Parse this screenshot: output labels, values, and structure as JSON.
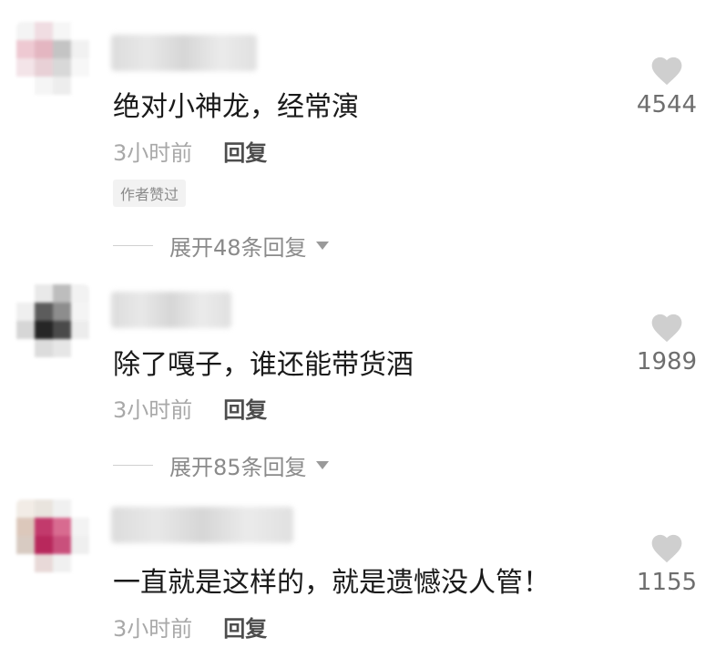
{
  "comments": [
    {
      "text": "绝对小神龙，经常演",
      "time": "3小时前",
      "reply_label": "回复",
      "badge": "作者赞过",
      "expand_label": "展开48条回复",
      "likes": "4544"
    },
    {
      "text": "除了嘎子，谁还能带货酒",
      "time": "3小时前",
      "reply_label": "回复",
      "expand_label": "展开85条回复",
      "likes": "1989"
    },
    {
      "text": "一直就是这样的，就是遗憾没人管！",
      "time": "3小时前",
      "reply_label": "回复",
      "likes": "1155"
    }
  ],
  "icons": {
    "like": "heart-icon",
    "expand": "triangle-down-icon"
  },
  "colors": {
    "heart": "#cfcfcf",
    "text": "#1a1a1a",
    "time": "#a8a8a8",
    "reply": "#4d4d4d"
  }
}
